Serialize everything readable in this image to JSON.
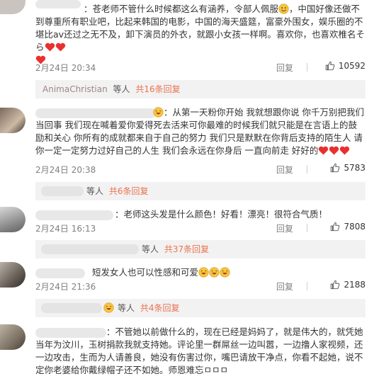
{
  "comments": [
    {
      "text_a": "：苍老师不管什么时候都这么有涵养，令部人佩服",
      "text_b": "，中国好像还做不到尊重所有职业吧，比起来韩国的电影，中国的海天盛筵，富豪外围女，娱乐圈的不堪比av还过之无不及，卸下演员的外衣，就跟小女孩一样啊。喜欢你，也喜欢椎名そら",
      "date": "2月24日 20:34",
      "reply": "回复",
      "likes": "10592"
    },
    {
      "text": "：从第一天粉你开始 我就想跟你说 你千万别把我们当回事 我们现在喊着爱你爱得死去活来可你最难的时候我们就只能是在言语上的鼓励和关心 你所有的成就都来自于自己的努力 我们只是默默在你背后支持的陌生人  请你一定一定努力过好自己的人生 我们会永远在你身后 一直向前走 好好的",
      "date": "2月24日 20:38",
      "reply": "回复",
      "likes": "5783"
    },
    {
      "text": "：老师这头发是什么颜色！好看！漂亮！很符合气质！",
      "date": "2月24日 16:13",
      "reply": "回复",
      "likes": "7808"
    },
    {
      "text": "短发女人也可以性感和可爱",
      "date": "2月24日 21:36",
      "reply": "回复",
      "likes": "2188"
    },
    {
      "text": "：不管她以前做什么的，现在已经是妈妈了，就是伟大的，就凭她当年为汶川，玉树捐款我就支持她。评论里一群屌丝一边叫嚣，一边撸人家视频，还一边攻击，生而为人请善良，她没有伤害过你，嘴巴请放干净点，你看不起她，说不定你老婆给你戴绿帽子还不如她。师恩难忘ㅁㅁㅁ"
    }
  ],
  "sub_replies": [
    {
      "name": "AnimaChristian",
      "etc": "等人",
      "more": "共16条回复"
    },
    {
      "name": "",
      "etc": "等人",
      "more": "共6条回复"
    },
    {
      "name": "",
      "etc": "等人",
      "more": "共37条回复"
    },
    {
      "name": "",
      "etc": "等人",
      "more": "共4条回复"
    }
  ],
  "icons": {
    "heart": "heart-emoji-icon",
    "smile": "smile-emoji-icon",
    "laugh": "laughing-emoji-icon",
    "like": "thumbs-up-icon"
  },
  "colors": {
    "more_link": "#eb7350",
    "heart": "#e8312f",
    "subbar_bg": "#f2f2f2"
  }
}
